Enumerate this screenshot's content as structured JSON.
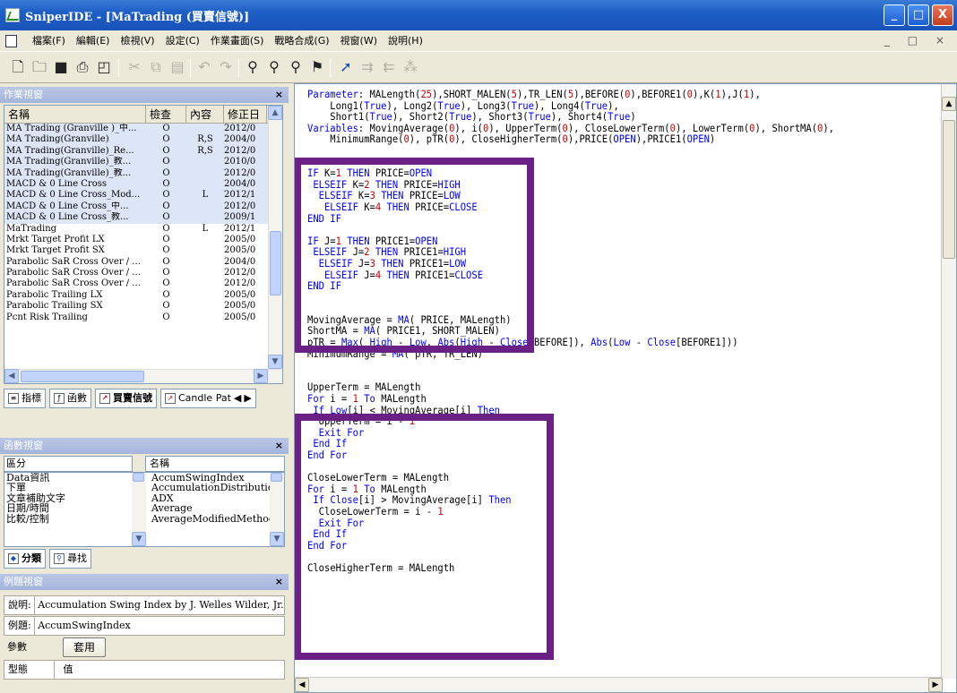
{
  "window": {
    "title": "SniperIDE - [MaTrading (買賣信號)]",
    "min_glyph": "_",
    "max_glyph": "□",
    "close_glyph": "X"
  },
  "menu": [
    "檔案(F)",
    "編輯(E)",
    "檢視(V)",
    "設定(C)",
    "作業畫面(S)",
    "戰略合成(G)",
    "視窗(W)",
    "說明(H)"
  ],
  "mdi_controls": "_ □ ×",
  "toolbar_icons": [
    "new-icon",
    "open-icon",
    "save-icon",
    "print-icon",
    "print-preview-icon",
    "cut-icon",
    "copy-icon",
    "paste-icon",
    "undo-icon",
    "redo-icon",
    "find-icon",
    "find-next-icon",
    "replace-icon",
    "bookmark-icon",
    "compile-icon",
    "indent-icon",
    "outdent-icon",
    "comment-icon"
  ],
  "work_pane": {
    "title": "作業視窗",
    "close": "×",
    "columns": [
      "名稱",
      "檢查",
      "內容",
      "修正日"
    ],
    "rows": [
      [
        "MA Trading (Granville )_中...",
        "O",
        "",
        "2012/0"
      ],
      [
        "MA Trading(Granville)",
        "O",
        "R,S",
        "2004/0"
      ],
      [
        "MA Trading(Granville)_Re...",
        "O",
        "R,S",
        "2012/0"
      ],
      [
        "MA Trading(Granville)_教...",
        "O",
        "",
        "2010/0"
      ],
      [
        "MA Trading(Granville)_教...",
        "O",
        "",
        "2012/0"
      ],
      [
        "MACD & 0 Line Cross",
        "O",
        "",
        "2004/0"
      ],
      [
        "MACD & 0 Line Cross_Mod...",
        "O",
        "L",
        "2012/1"
      ],
      [
        "MACD & 0 Line Cross_中...",
        "O",
        "",
        "2012/0"
      ],
      [
        "MACD & 0 Line Cross_教...",
        "O",
        "",
        "2009/1"
      ],
      [
        "MaTrading",
        "O",
        "L",
        "2012/1"
      ],
      [
        "Mrkt Target Profit LX",
        "O",
        "",
        "2005/0"
      ],
      [
        "Mrkt Target Profit SX",
        "O",
        "",
        "2005/0"
      ],
      [
        "Parabolic SaR Cross Over / ...",
        "O",
        "",
        "2004/0"
      ],
      [
        "Parabolic SaR Cross Over / ...",
        "O",
        "",
        "2012/0"
      ],
      [
        "Parabolic SaR Cross Over / ...",
        "O",
        "",
        "2012/0"
      ],
      [
        "Parabolic Trailing LX",
        "O",
        "",
        "2005/0"
      ],
      [
        "Parabolic Trailing SX",
        "O",
        "",
        "2005/0"
      ],
      [
        "Pcnt Risk Trailing",
        "O",
        "",
        "2005/0"
      ]
    ],
    "tabs": [
      "指標",
      "函數",
      "買賣信號",
      "Candle Pat"
    ]
  },
  "func_pane": {
    "title": "函數視窗",
    "close": "×",
    "col1_header": "區分",
    "col2_header": "名稱",
    "categories": [
      "Data資訊",
      "下單",
      "文章補助文字",
      "日期/時間",
      "比較/控制"
    ],
    "functions": [
      "AccumSwingIndex",
      "AccumulationDistribution",
      "ADX",
      "Average",
      "AverageModifiedMethod"
    ],
    "tabs": [
      "分類",
      "尋找"
    ]
  },
  "example_pane": {
    "title": "例題視窗",
    "close": "×",
    "desc_label": "說明",
    "desc_value": "Accumulation Swing Index by J. Welles Wilder, Jr.",
    "example_label": "例題",
    "example_value": "AccumSwingIndex",
    "param_label": "參數",
    "apply_button": "套用",
    "type_label": "型態",
    "value_label": "值"
  },
  "code_lines": [
    [
      [
        "kw",
        "Parameter"
      ],
      [
        "t",
        ": MALength("
      ],
      [
        "num",
        "25"
      ],
      [
        "t",
        "),SHORT_MALEN("
      ],
      [
        "num",
        "5"
      ],
      [
        "t",
        "),TR_LEN("
      ],
      [
        "num",
        "5"
      ],
      [
        "t",
        "),BEFORE("
      ],
      [
        "num",
        "0"
      ],
      [
        "t",
        "),BEFORE1("
      ],
      [
        "num",
        "0"
      ],
      [
        "t",
        "),K("
      ],
      [
        "num",
        "1"
      ],
      [
        "t",
        "),J("
      ],
      [
        "num",
        "1"
      ],
      [
        "t",
        "),"
      ]
    ],
    [
      [
        "t",
        "    Long1("
      ],
      [
        "kw",
        "True"
      ],
      [
        "t",
        "), Long2("
      ],
      [
        "kw",
        "True"
      ],
      [
        "t",
        "), Long3("
      ],
      [
        "kw",
        "True"
      ],
      [
        "t",
        "), Long4("
      ],
      [
        "kw",
        "True"
      ],
      [
        "t",
        "),"
      ]
    ],
    [
      [
        "t",
        "    Short1("
      ],
      [
        "kw",
        "True"
      ],
      [
        "t",
        "), Short2("
      ],
      [
        "kw",
        "True"
      ],
      [
        "t",
        "), Short3("
      ],
      [
        "kw",
        "True"
      ],
      [
        "t",
        "), Short4("
      ],
      [
        "kw",
        "True"
      ],
      [
        "t",
        ")"
      ]
    ],
    [
      [
        "kw",
        "Variables"
      ],
      [
        "t",
        ": MovingAverage("
      ],
      [
        "num",
        "0"
      ],
      [
        "t",
        "), i("
      ],
      [
        "num",
        "0"
      ],
      [
        "t",
        "), UpperTerm("
      ],
      [
        "num",
        "0"
      ],
      [
        "t",
        "), CloseLowerTerm("
      ],
      [
        "num",
        "0"
      ],
      [
        "t",
        "), LowerTerm("
      ],
      [
        "num",
        "0"
      ],
      [
        "t",
        "), ShortMA("
      ],
      [
        "num",
        "0"
      ],
      [
        "t",
        "),"
      ]
    ],
    [
      [
        "t",
        "    MinimumRange("
      ],
      [
        "num",
        "0"
      ],
      [
        "t",
        "), pTR("
      ],
      [
        "num",
        "0"
      ],
      [
        "t",
        "), CloseHigherTerm("
      ],
      [
        "num",
        "0"
      ],
      [
        "t",
        "),PRICE("
      ],
      [
        "kw",
        "OPEN"
      ],
      [
        "t",
        "),PRICE1("
      ],
      [
        "kw",
        "OPEN"
      ],
      [
        "t",
        ")"
      ]
    ],
    [
      [
        "t",
        ""
      ]
    ],
    [
      [
        "t",
        ""
      ]
    ],
    [
      [
        "kw",
        "IF"
      ],
      [
        "t",
        " K="
      ],
      [
        "num",
        "1"
      ],
      [
        "t",
        " "
      ],
      [
        "kw",
        "THEN"
      ],
      [
        "t",
        " PRICE="
      ],
      [
        "kw",
        "OPEN"
      ]
    ],
    [
      [
        "t",
        " "
      ],
      [
        "kw",
        "ELSEIF"
      ],
      [
        "t",
        " K="
      ],
      [
        "num",
        "2"
      ],
      [
        "t",
        " "
      ],
      [
        "kw",
        "THEN"
      ],
      [
        "t",
        " PRICE="
      ],
      [
        "kw",
        "HIGH"
      ]
    ],
    [
      [
        "t",
        "  "
      ],
      [
        "kw",
        "ELSEIF"
      ],
      [
        "t",
        " K="
      ],
      [
        "num",
        "3"
      ],
      [
        "t",
        " "
      ],
      [
        "kw",
        "THEN"
      ],
      [
        "t",
        " PRICE="
      ],
      [
        "kw",
        "LOW"
      ]
    ],
    [
      [
        "t",
        "   "
      ],
      [
        "kw",
        "ELSEIF"
      ],
      [
        "t",
        " K="
      ],
      [
        "num",
        "4"
      ],
      [
        "t",
        " "
      ],
      [
        "kw",
        "THEN"
      ],
      [
        "t",
        " PRICE="
      ],
      [
        "kw",
        "CLOSE"
      ]
    ],
    [
      [
        "kw",
        "END IF"
      ]
    ],
    [
      [
        "t",
        ""
      ]
    ],
    [
      [
        "kw",
        "IF"
      ],
      [
        "t",
        " J="
      ],
      [
        "num",
        "1"
      ],
      [
        "t",
        " "
      ],
      [
        "kw",
        "THEN"
      ],
      [
        "t",
        " PRICE1="
      ],
      [
        "kw",
        "OPEN"
      ]
    ],
    [
      [
        "t",
        " "
      ],
      [
        "kw",
        "ELSEIF"
      ],
      [
        "t",
        " J="
      ],
      [
        "num",
        "2"
      ],
      [
        "t",
        " "
      ],
      [
        "kw",
        "THEN"
      ],
      [
        "t",
        " PRICE1="
      ],
      [
        "kw",
        "HIGH"
      ]
    ],
    [
      [
        "t",
        "  "
      ],
      [
        "kw",
        "ELSEIF"
      ],
      [
        "t",
        " J="
      ],
      [
        "num",
        "3"
      ],
      [
        "t",
        " "
      ],
      [
        "kw",
        "THEN"
      ],
      [
        "t",
        " PRICE1="
      ],
      [
        "kw",
        "LOW"
      ]
    ],
    [
      [
        "t",
        "   "
      ],
      [
        "kw",
        "ELSEIF"
      ],
      [
        "t",
        " J="
      ],
      [
        "num",
        "4"
      ],
      [
        "t",
        " "
      ],
      [
        "kw",
        "THEN"
      ],
      [
        "t",
        " PRICE1="
      ],
      [
        "kw",
        "CLOSE"
      ]
    ],
    [
      [
        "kw",
        "END IF"
      ]
    ],
    [
      [
        "t",
        ""
      ]
    ],
    [
      [
        "t",
        ""
      ]
    ],
    [
      [
        "t",
        "MovingAverage = "
      ],
      [
        "kw",
        "MA"
      ],
      [
        "t",
        "( PRICE, MALength)"
      ]
    ],
    [
      [
        "t",
        "ShortMA = "
      ],
      [
        "kw",
        "MA"
      ],
      [
        "t",
        "( PRICE1, SHORT_MALEN)"
      ]
    ],
    [
      [
        "t",
        "pTR = "
      ],
      [
        "kw",
        "Max"
      ],
      [
        "t",
        "( "
      ],
      [
        "kw",
        "High"
      ],
      [
        "t",
        " - "
      ],
      [
        "kw",
        "Low"
      ],
      [
        "t",
        ", "
      ],
      [
        "kw",
        "Abs"
      ],
      [
        "t",
        "("
      ],
      [
        "kw",
        "High"
      ],
      [
        "t",
        " - "
      ],
      [
        "kw",
        "Close"
      ],
      [
        "t",
        "[BEFORE]), "
      ],
      [
        "kw",
        "Abs"
      ],
      [
        "t",
        "("
      ],
      [
        "kw",
        "Low"
      ],
      [
        "t",
        " - "
      ],
      [
        "kw",
        "Close"
      ],
      [
        "t",
        "[BEFORE1]))"
      ]
    ],
    [
      [
        "t",
        "MinimumRange = "
      ],
      [
        "kw",
        "MA"
      ],
      [
        "t",
        "( pTR, TR_LEN)"
      ]
    ],
    [
      [
        "t",
        ""
      ]
    ],
    [
      [
        "t",
        ""
      ]
    ],
    [
      [
        "t",
        "UpperTerm = MALength"
      ]
    ],
    [
      [
        "kw",
        "For"
      ],
      [
        "t",
        " i = "
      ],
      [
        "num",
        "1"
      ],
      [
        "t",
        " "
      ],
      [
        "kw",
        "To"
      ],
      [
        "t",
        " MALength"
      ]
    ],
    [
      [
        "t",
        " "
      ],
      [
        "kw",
        "If"
      ],
      [
        "t",
        " "
      ],
      [
        "kw",
        "Low"
      ],
      [
        "t",
        "[i] < MovingAverage[i] "
      ],
      [
        "kw",
        "Then"
      ]
    ],
    [
      [
        "t",
        "  UpperTerm = i - "
      ],
      [
        "num",
        "1"
      ]
    ],
    [
      [
        "t",
        "  "
      ],
      [
        "kw",
        "Exit For"
      ]
    ],
    [
      [
        "t",
        " "
      ],
      [
        "kw",
        "End If"
      ]
    ],
    [
      [
        "kw",
        "End For"
      ]
    ],
    [
      [
        "t",
        ""
      ]
    ],
    [
      [
        "t",
        "CloseLowerTerm = MALength"
      ]
    ],
    [
      [
        "kw",
        "For"
      ],
      [
        "t",
        " i = "
      ],
      [
        "num",
        "1"
      ],
      [
        "t",
        " "
      ],
      [
        "kw",
        "To"
      ],
      [
        "t",
        " MALength"
      ]
    ],
    [
      [
        "t",
        " "
      ],
      [
        "kw",
        "If"
      ],
      [
        "t",
        " "
      ],
      [
        "kw",
        "Close"
      ],
      [
        "t",
        "[i] > MovingAverage[i] "
      ],
      [
        "kw",
        "Then"
      ]
    ],
    [
      [
        "t",
        "  CloseLowerTerm = i - "
      ],
      [
        "num",
        "1"
      ]
    ],
    [
      [
        "t",
        "  "
      ],
      [
        "kw",
        "Exit For"
      ]
    ],
    [
      [
        "t",
        " "
      ],
      [
        "kw",
        "End If"
      ]
    ],
    [
      [
        "kw",
        "End For"
      ]
    ],
    [
      [
        "t",
        ""
      ]
    ],
    [
      [
        "t",
        "CloseHigherTerm = MALength"
      ]
    ]
  ]
}
